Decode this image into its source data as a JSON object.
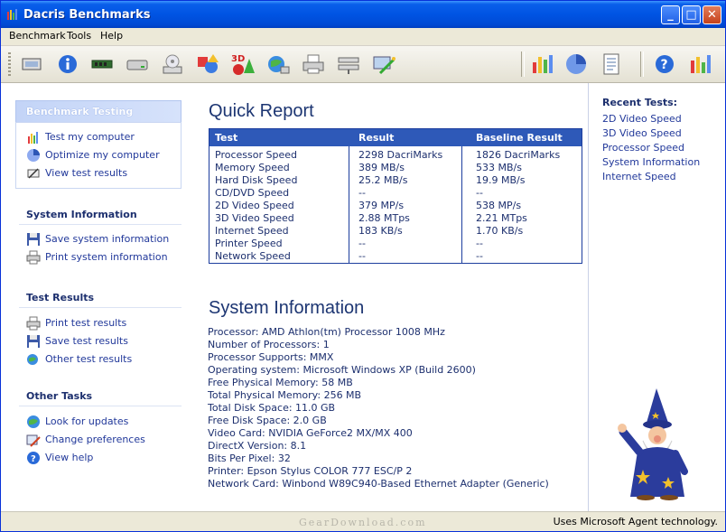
{
  "window": {
    "title": "Dacris Benchmarks"
  },
  "menu": [
    "Benchmark",
    "Tools",
    "Help"
  ],
  "sidebar": {
    "benchmark": {
      "title": "Benchmark Testing",
      "items": [
        "Test my computer",
        "Optimize my computer",
        "View test results"
      ]
    },
    "system": {
      "title": "System Information",
      "items": [
        "Save system information",
        "Print system information"
      ]
    },
    "results": {
      "title": "Test Results",
      "items": [
        "Print test results",
        "Save test results",
        "Other test results"
      ]
    },
    "other": {
      "title": "Other Tasks",
      "items": [
        "Look for updates",
        "Change preferences",
        "View help"
      ]
    }
  },
  "quick_report": {
    "title": "Quick Report",
    "headers": [
      "Test",
      "Result",
      "Baseline Result"
    ],
    "rows": [
      [
        "Processor Speed",
        "2298 DacriMarks",
        "1826 DacriMarks"
      ],
      [
        "Memory Speed",
        "389 MB/s",
        "533 MB/s"
      ],
      [
        "Hard Disk Speed",
        "25.2 MB/s",
        "19.9 MB/s"
      ],
      [
        "CD/DVD Speed",
        "--",
        "--"
      ],
      [
        "2D Video Speed",
        "379 MP/s",
        "538 MP/s"
      ],
      [
        "3D Video Speed",
        "2.88 MTps",
        "2.21 MTps"
      ],
      [
        "Internet Speed",
        "183 KB/s",
        "1.70 KB/s"
      ],
      [
        "Printer Speed",
        "--",
        "--"
      ],
      [
        "Network Speed",
        "--",
        "--"
      ]
    ]
  },
  "system_info": {
    "title": "System Information",
    "lines": [
      "Processor: AMD Athlon(tm) Processor 1008 MHz",
      "Number of Processors: 1",
      "Processor Supports: MMX",
      "Operating system: Microsoft Windows XP  (Build 2600)",
      "Free Physical Memory: 58 MB",
      "Total Physical Memory: 256 MB",
      "Total Disk Space: 11.0 GB",
      "Free Disk Space: 2.0 GB",
      "Video Card: NVIDIA GeForce2 MX/MX 400",
      "DirectX Version: 8.1",
      "Bits Per Pixel: 32",
      "Printer: Epson Stylus COLOR 777 ESC/P 2",
      "Network Card: Winbond W89C940-Based Ethernet Adapter (Generic)"
    ]
  },
  "recent": {
    "title": "Recent Tests:",
    "items": [
      "2D Video Speed",
      "3D Video Speed",
      "Processor Speed",
      "System Information",
      "Internet Speed"
    ]
  },
  "status": {
    "text": "Uses Microsoft Agent technology."
  },
  "watermark": "GearDownload.com",
  "colors": {
    "title_bar": "#0054e3",
    "link": "#21389a",
    "table_header": "#2e59b8"
  }
}
